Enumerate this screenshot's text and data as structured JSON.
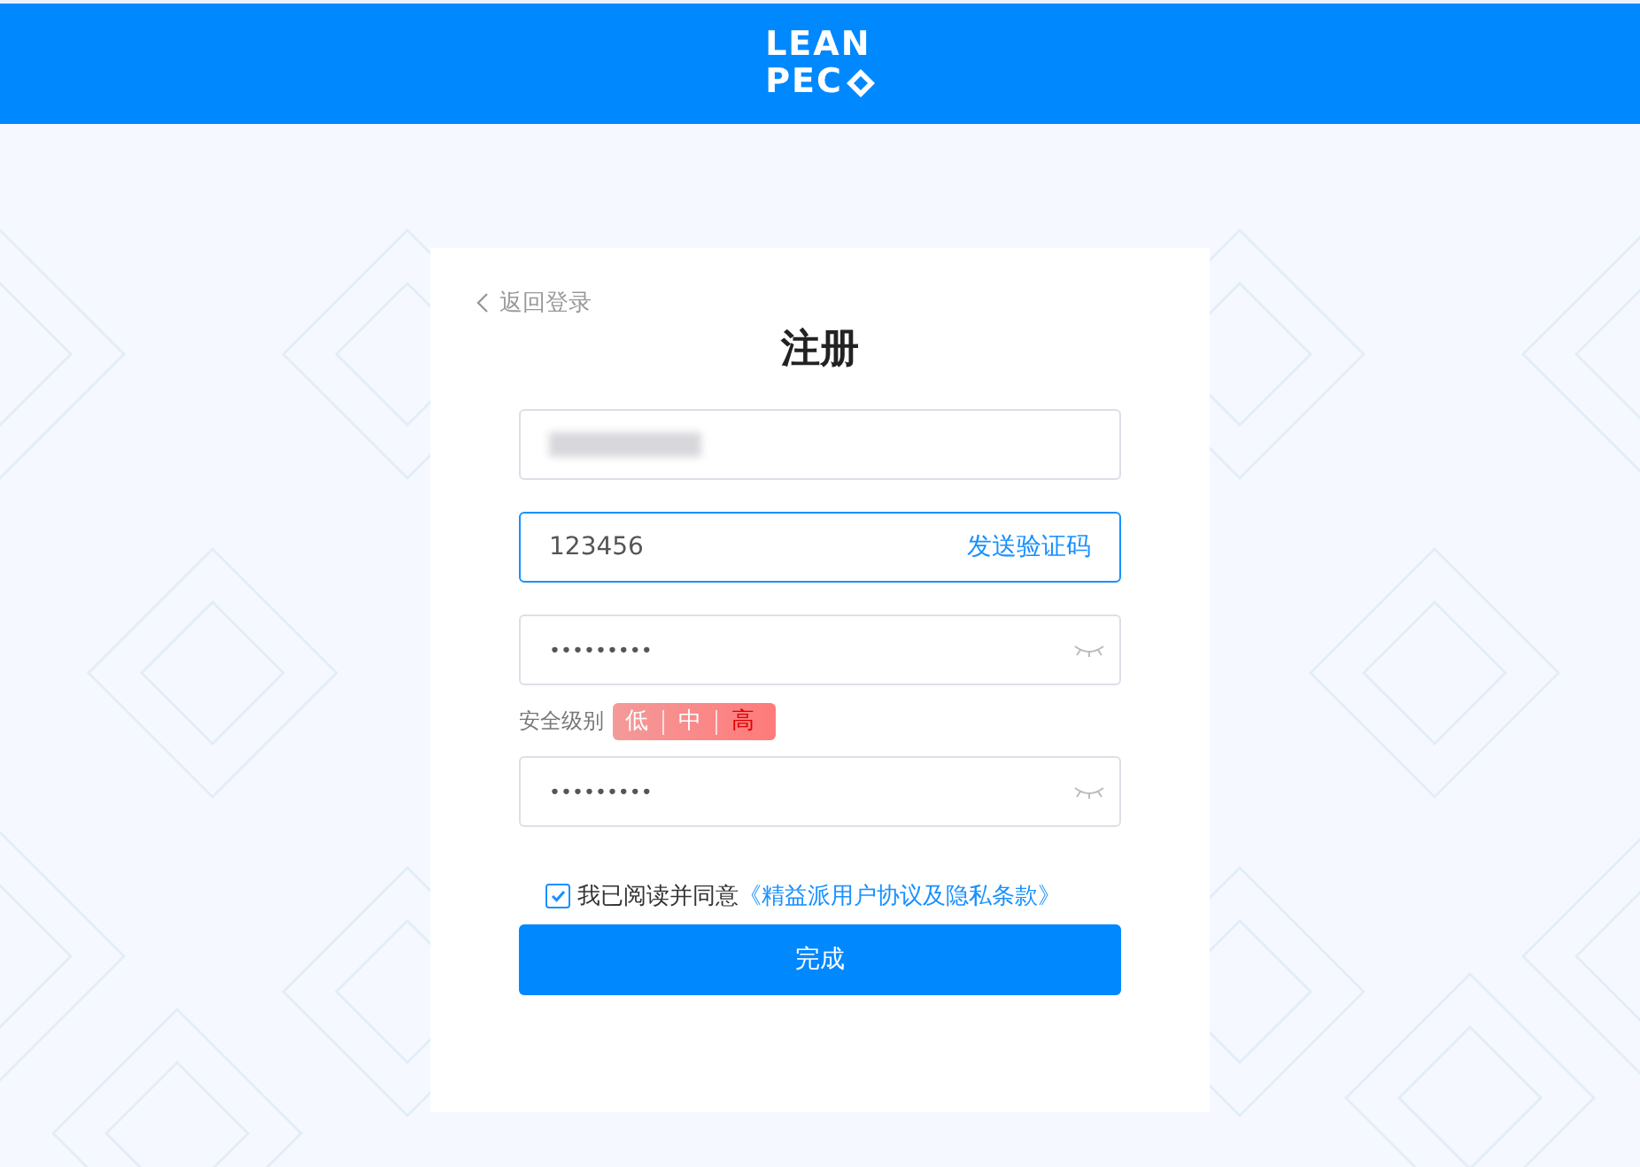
{
  "header": {
    "logo": {
      "line_1": "LEAN",
      "line_2": "PEC"
    }
  },
  "form": {
    "back_link": "返回登录",
    "title": "注册",
    "account": {
      "kind": "redacted"
    },
    "code": {
      "value": "123456",
      "send_button": "发送验证码",
      "focused": true
    },
    "password": {
      "value": "•••••••••"
    },
    "strength": {
      "label": "安全级别",
      "levels": [
        {
          "label": "低",
          "selected": false
        },
        {
          "label": "中",
          "selected": false
        },
        {
          "label": "高",
          "selected": true
        }
      ]
    },
    "confirm_password": {
      "value": "•••••••••"
    },
    "agreement": {
      "checked": true,
      "text": "我已阅读并同意",
      "link": "《精益派用户协议及隐私条款》"
    },
    "submit": "完成"
  }
}
